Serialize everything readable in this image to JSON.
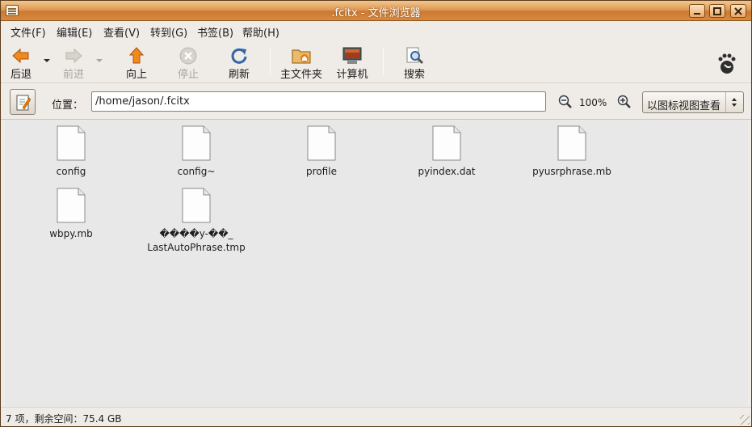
{
  "window": {
    "title": ".fcitx - 文件浏览器",
    "minimize_icon": "minimize-icon",
    "maximize_icon": "maximize-icon",
    "close_icon": "close-icon"
  },
  "menubar": {
    "items": [
      {
        "label": "文件(F)"
      },
      {
        "label": "编辑(E)"
      },
      {
        "label": "查看(V)"
      },
      {
        "label": "转到(G)"
      },
      {
        "label": "书签(B)"
      },
      {
        "label": "帮助(H)"
      }
    ]
  },
  "toolbar": {
    "back_label": "后退",
    "forward_label": "前进",
    "up_label": "向上",
    "stop_label": "停止",
    "reload_label": "刷新",
    "home_label": "主文件夹",
    "computer_label": "计算机",
    "search_label": "搜索"
  },
  "location": {
    "label": "位置：",
    "path": "/home/jason/.fcitx",
    "zoom_level": "100%",
    "view_mode": "以图标视图查看"
  },
  "files": [
    {
      "name": "config"
    },
    {
      "name": "config~"
    },
    {
      "name": "profile"
    },
    {
      "name": "pyindex.dat"
    },
    {
      "name": "pyusrphrase.mb"
    },
    {
      "name": "wbpy.mb"
    },
    {
      "name": "����y-��_\nLastAutoPhrase.tmp"
    }
  ],
  "status": {
    "text": "7 项，剩余空间：75.4 GB"
  },
  "colors": {
    "titlebar_accent": "#e09a55",
    "iconview_bg": "#e8e8e8"
  }
}
